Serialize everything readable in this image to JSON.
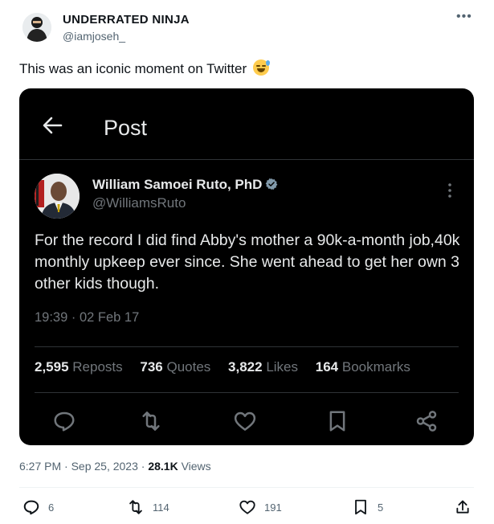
{
  "author": {
    "name": "UNDERRATED NINJA",
    "handle": "@iamjoseh_"
  },
  "tweet_text": "This was an iconic moment on Twitter",
  "embedded": {
    "header_title": "Post",
    "name": "William Samoei Ruto, PhD",
    "handle": "@WilliamsRuto",
    "text": "For the record I did find Abby's mother a 90k-a-month job,40k monthly upkeep ever since. She went ahead to get her own 3 other kids though.",
    "timestamp": "19:39 · 02 Feb 17",
    "stats": [
      {
        "value": "2,595",
        "label": "Reposts"
      },
      {
        "value": "736",
        "label": "Quotes"
      },
      {
        "value": "3,822",
        "label": "Likes"
      },
      {
        "value": "164",
        "label": "Bookmarks"
      }
    ],
    "icons": [
      "back-arrow-icon",
      "verified-badge-icon",
      "more-vertical-icon",
      "reply-icon",
      "retweet-icon",
      "like-icon",
      "bookmark-icon",
      "share-icon"
    ]
  },
  "meta": {
    "time": "6:27 PM · Sep 25, 2023 · ",
    "views_count": "28.1K",
    "views_label": " Views"
  },
  "actions": {
    "reply_count": "6",
    "repost_count": "114",
    "like_count": "191",
    "bookmark_count": "5"
  },
  "colors": {
    "card_bg": "#000000",
    "verified": "#829aab",
    "secondary_text": "#536471"
  }
}
